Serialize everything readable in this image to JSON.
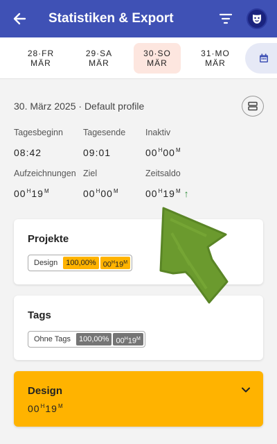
{
  "appbar": {
    "title": "Statistiken & Export",
    "back_icon": "arrow-left-icon",
    "filter_icon": "filter-icon",
    "avatar_icon": "mask-icon"
  },
  "dates": [
    {
      "line1": "28·FR",
      "line2": "MÄR",
      "selected": false
    },
    {
      "line1": "29·SA",
      "line2": "MÄR",
      "selected": false
    },
    {
      "line1": "30·SO",
      "line2": "MÄR",
      "selected": true
    },
    {
      "line1": "31·MO",
      "line2": "MÄR",
      "selected": false
    }
  ],
  "summary": {
    "heading": "30. März 2025 · Default profile",
    "tagesbeginn_label": "Tagesbeginn",
    "tagesbeginn_value": "08:42",
    "tagesende_label": "Tagesende",
    "tagesende_value": "09:01",
    "inaktiv_label": "Inaktiv",
    "inaktiv_h": "00",
    "inaktiv_m": "00",
    "aufz_label": "Aufzeichnungen",
    "aufz_h": "00",
    "aufz_m": "19",
    "ziel_label": "Ziel",
    "ziel_h": "00",
    "ziel_m": "00",
    "saldo_label": "Zeitsaldo",
    "saldo_h": "00",
    "saldo_m": "19",
    "unit_h": "H",
    "unit_m": "M"
  },
  "projekte": {
    "title": "Projekte",
    "name": "Design",
    "percent": "100,00%",
    "h": "00",
    "m": "19",
    "color": "#ffb300"
  },
  "tags": {
    "title": "Tags",
    "name": "Ohne Tags",
    "percent": "100,00%",
    "h": "00",
    "m": "19",
    "color": "#757575"
  },
  "expanded": {
    "title": "Design",
    "h": "00",
    "m": "19",
    "color": "#ffb300"
  }
}
